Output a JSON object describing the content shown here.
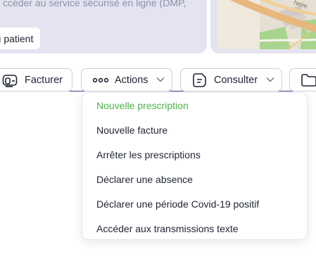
{
  "top": {
    "info_text": "ccéder au service sécurisé en ligne (DMP,",
    "patient_button": "u patient",
    "map_label": "heim"
  },
  "toolbar": {
    "facturer_label": "Facturer",
    "actions_label": "Actions",
    "consulter_label": "Consulter"
  },
  "actions_menu": {
    "items": [
      {
        "label": "Nouvelle prescription",
        "active": true
      },
      {
        "label": "Nouvelle facture"
      },
      {
        "label": "Arrêter les prescriptions"
      },
      {
        "label": "Déclarer une absence"
      },
      {
        "label": "Déclarer une période Covid-19 positif"
      },
      {
        "label": "Accéder aux transmissions texte"
      }
    ]
  },
  "colors": {
    "accent_green": "#4fb34a",
    "card_bg": "#e3e4f0",
    "divider": "#3d3f8a"
  },
  "icons": {
    "facturer": "billing-icon",
    "actions": "more-dots-icon",
    "consulter": "document-icon",
    "folder": "folder-icon",
    "chevron": "chevron-down-icon"
  }
}
